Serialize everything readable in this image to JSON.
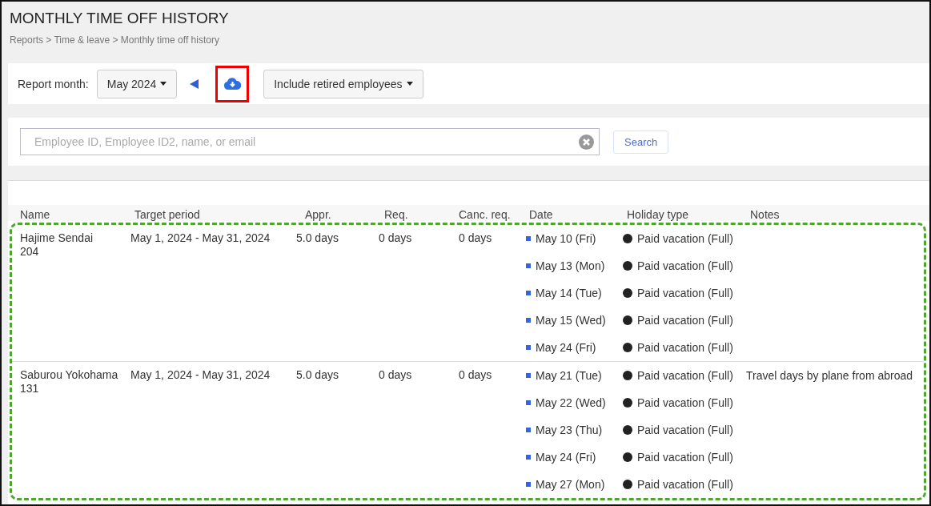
{
  "title": "MONTHLY TIME OFF HISTORY",
  "breadcrumb": "Reports > Time & leave > Monthly time off history",
  "toolbar": {
    "label": "Report month:",
    "month": "May 2024",
    "filter": "Include retired employees"
  },
  "search": {
    "placeholder": "Employee ID, Employee ID2, name, or email",
    "button": "Search"
  },
  "table": {
    "columns": [
      "Name",
      "Target period",
      "Appr.",
      "Req.",
      "Canc. req.",
      "Date",
      "Holiday type",
      "Notes"
    ],
    "rows": [
      {
        "name": "Hajime Sendai",
        "id": "204",
        "period": "May 1, 2024 - May 31, 2024",
        "approved": "5.0 days",
        "requested": "0 days",
        "cancel_requested": "0 days",
        "entries": [
          {
            "date": "May 10 (Fri)",
            "holiday_type": "Paid vacation (Full)"
          },
          {
            "date": "May 13 (Mon)",
            "holiday_type": "Paid vacation (Full)"
          },
          {
            "date": "May 14 (Tue)",
            "holiday_type": "Paid vacation (Full)"
          },
          {
            "date": "May 15 (Wed)",
            "holiday_type": "Paid vacation (Full)"
          },
          {
            "date": "May 24 (Fri)",
            "holiday_type": "Paid vacation (Full)"
          }
        ]
      },
      {
        "name": "Saburou Yokohama",
        "id": "131",
        "period": "May 1, 2024 - May 31, 2024",
        "approved": "5.0 days",
        "requested": "0 days",
        "cancel_requested": "0 days",
        "entries": [
          {
            "date": "May 21 (Tue)",
            "holiday_type": "Paid vacation (Full)",
            "notes": "Travel days by plane from abroad"
          },
          {
            "date": "May 22 (Wed)",
            "holiday_type": "Paid vacation (Full)"
          },
          {
            "date": "May 23 (Thu)",
            "holiday_type": "Paid vacation (Full)"
          },
          {
            "date": "May 24 (Fri)",
            "holiday_type": "Paid vacation (Full)"
          },
          {
            "date": "May 27 (Mon)",
            "holiday_type": "Paid vacation (Full)"
          }
        ]
      }
    ]
  }
}
